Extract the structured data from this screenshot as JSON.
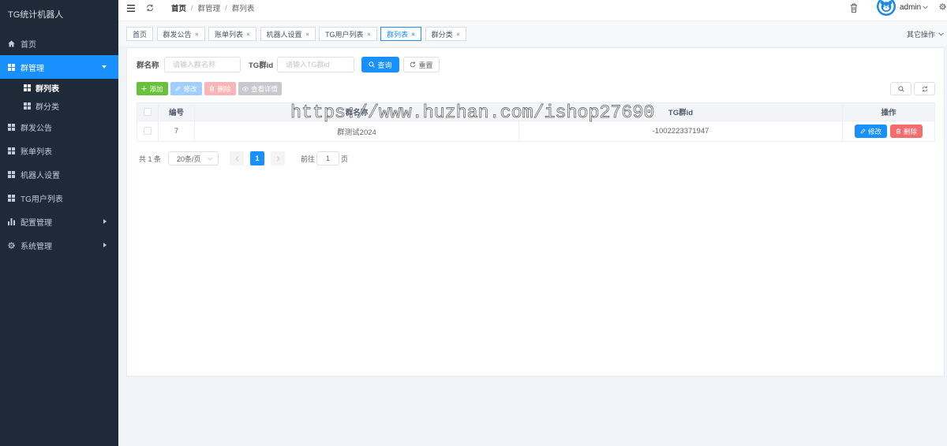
{
  "app": {
    "title": "TG统计机器人"
  },
  "sidebar": {
    "items": [
      {
        "label": "首页",
        "icon": "home-icon"
      },
      {
        "label": "群管理",
        "icon": "grid-icon",
        "active": true,
        "expanded": true,
        "children": [
          {
            "label": "群列表",
            "icon": "grid-icon",
            "active": true
          },
          {
            "label": "群分类",
            "icon": "grid-icon"
          }
        ]
      },
      {
        "label": "群发公告",
        "icon": "grid-icon"
      },
      {
        "label": "账单列表",
        "icon": "grid-icon"
      },
      {
        "label": "机器人设置",
        "icon": "grid-icon"
      },
      {
        "label": "TG用户列表",
        "icon": "grid-icon"
      },
      {
        "label": "配置管理",
        "icon": "bar-chart-icon",
        "has_submenu": true
      },
      {
        "label": "系统管理",
        "icon": "gear-icon",
        "has_submenu": true
      }
    ]
  },
  "header": {
    "breadcrumb": [
      "首页",
      "群管理",
      "群列表"
    ],
    "breadcrumb_separator": "/",
    "username": "admin",
    "icons": {
      "toggle": "menu-fold-icon",
      "reload": "refresh-icon",
      "clear": "trash-icon",
      "user": "avatar",
      "settings": "gear-icon"
    }
  },
  "tabs": {
    "items": [
      {
        "label": "首页",
        "closable": false
      },
      {
        "label": "群发公告",
        "closable": true
      },
      {
        "label": "账单列表",
        "closable": true
      },
      {
        "label": "机器人设置",
        "closable": true
      },
      {
        "label": "TG用户列表",
        "closable": true
      },
      {
        "label": "群列表",
        "closable": true,
        "active": true
      },
      {
        "label": "群分类",
        "closable": true
      }
    ],
    "other_ops_label": "其它操作"
  },
  "search": {
    "fields": [
      {
        "label": "群名称",
        "placeholder": "请输入群名称",
        "value": ""
      },
      {
        "label": "TG群id",
        "placeholder": "请输入TG群id",
        "value": ""
      }
    ],
    "query_label": "查询",
    "reset_label": "重置"
  },
  "toolbar": {
    "add_label": "添加",
    "edit_label": "修改",
    "delete_label": "删除",
    "detail_label": "查看详情"
  },
  "table": {
    "columns": [
      "编号",
      "群名称",
      "TG群id",
      "操作"
    ],
    "rows": [
      {
        "id": "7",
        "name": "群测试2024",
        "tg_group_id": "-1002223371947",
        "actions": [
          "修改",
          "删除"
        ]
      }
    ]
  },
  "pagination": {
    "total_text": "共 1 条",
    "page_size": "20条/页",
    "current_page": "1",
    "goto_label": "前往",
    "goto_value": "1",
    "page_unit": "页"
  },
  "watermark": "https://www.huzhan.com/ishop27690",
  "colors": {
    "sidebar_bg": "#1f2a38",
    "primary": "#1890ff",
    "success": "#67c23a",
    "danger": "#f56c6c",
    "page_bg": "#f0f3f7"
  }
}
